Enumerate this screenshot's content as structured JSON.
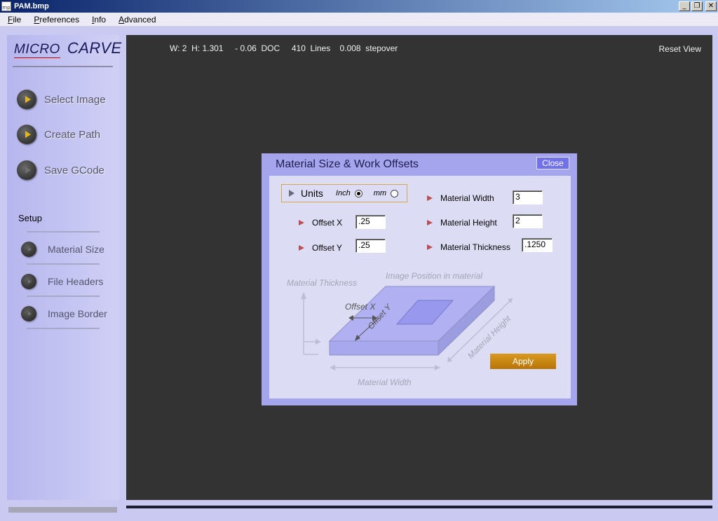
{
  "window": {
    "title": "PAM.bmp",
    "app_icon_text": "mp",
    "controls": {
      "minimize": "_",
      "restore": "❐",
      "close": "✕"
    }
  },
  "menu": {
    "items": [
      {
        "first": "F",
        "rest": "ile"
      },
      {
        "first": "P",
        "rest": "references"
      },
      {
        "first": "I",
        "rest": "nfo"
      },
      {
        "first": "A",
        "rest": "dvanced"
      }
    ]
  },
  "sidebar": {
    "logo_a": "MICRO",
    "logo_b": "CARVE",
    "actions": [
      {
        "label": "Select Image",
        "enabled": true
      },
      {
        "label": "Create Path",
        "enabled": true
      },
      {
        "label": "Save GCode",
        "enabled": false
      }
    ],
    "setup_label": "Setup",
    "setup_items": [
      "Material Size",
      "File Headers",
      "Image Border"
    ]
  },
  "status": {
    "text": "W: 2  H: 1.301     - 0.06  DOC     410  Lines    0.008  stepover",
    "reset_view": "Reset View"
  },
  "dialog": {
    "title": "Material Size & Work Offsets",
    "close_label": "Close",
    "units": {
      "label": "Units",
      "options": [
        "Inch",
        "mm"
      ],
      "selected": "Inch"
    },
    "offset_x": {
      "label": "Offset X",
      "value": ".25"
    },
    "offset_y": {
      "label": "Offset Y",
      "value": ".25"
    },
    "material_width": {
      "label": "Material Width",
      "value": "3"
    },
    "material_height": {
      "label": "Material Height",
      "value": "2"
    },
    "material_thickness": {
      "label": "Material Thickness",
      "value": ".1250"
    },
    "diagram": {
      "thickness": "Material Thickness",
      "image_position": "Image Position in material",
      "offset_x": "Offset X",
      "offset_y": "Offset Y",
      "height": "Material Height",
      "width": "Material Width"
    },
    "apply_label": "Apply"
  },
  "colors": {
    "accent": "#7272e8",
    "apply": "#c8860f",
    "view_bg": "#333333",
    "panel": "#c4c4f2"
  }
}
